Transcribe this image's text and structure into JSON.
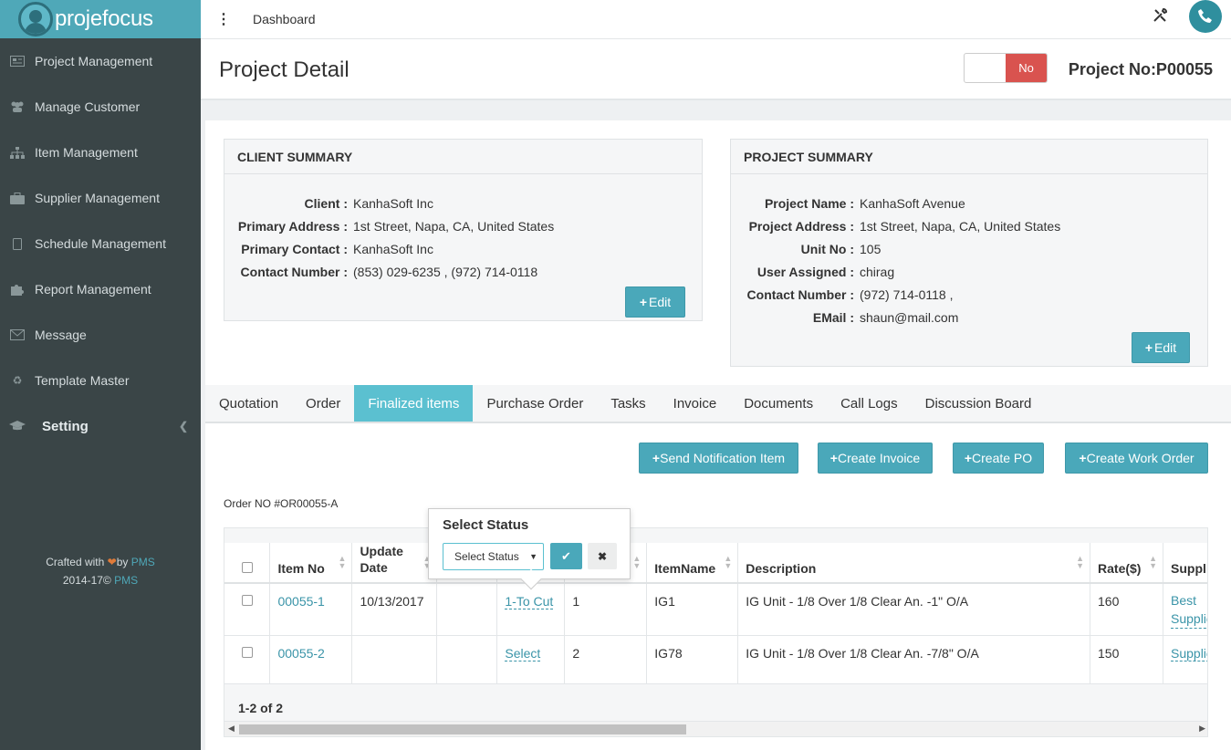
{
  "app": {
    "logo_text": "projefocus"
  },
  "sidebar": {
    "items": [
      {
        "label": "Project Management",
        "icon": "newspaper-icon"
      },
      {
        "label": "Manage Customer",
        "icon": "users-icon"
      },
      {
        "label": "Item Management",
        "icon": "sitemap-icon"
      },
      {
        "label": "Supplier Management",
        "icon": "briefcase-icon"
      },
      {
        "label": "Schedule Management",
        "icon": "tablet-icon"
      },
      {
        "label": "Report Management",
        "icon": "puzzle-icon"
      },
      {
        "label": "Message",
        "icon": "envelope-icon"
      },
      {
        "label": "Template Master",
        "icon": "recycle-icon"
      },
      {
        "label": "Setting",
        "icon": "graduation-cap-icon"
      }
    ],
    "credits_line1_prefix": "Crafted with ",
    "credits_line1_by": "by ",
    "credits_line1_link": "PMS",
    "credits_line2_prefix": "2014-17© ",
    "credits_line2_link": "PMS"
  },
  "topbar": {
    "breadcrumb": "Dashboard"
  },
  "header": {
    "title": "Project Detail",
    "toggle_label": "No",
    "project_no": "Project No:P00055"
  },
  "client_summary": {
    "title": "CLIENT SUMMARY",
    "rows": [
      {
        "key": "Client :",
        "value": "KanhaSoft Inc"
      },
      {
        "key": "Primary Address :",
        "value": "1st Street, Napa, CA, United States"
      },
      {
        "key": "Primary Contact :",
        "value": "KanhaSoft Inc"
      },
      {
        "key": "Contact Number :",
        "value": "(853) 029-6235 , (972) 714-0118"
      }
    ],
    "edit_label": "Edit"
  },
  "project_summary": {
    "title": "PROJECT SUMMARY",
    "rows": [
      {
        "key": "Project Name :",
        "value": "KanhaSoft Avenue"
      },
      {
        "key": "Project Address :",
        "value": "1st Street, Napa, CA, United States"
      },
      {
        "key": "Unit No :",
        "value": "105"
      },
      {
        "key": "User Assigned :",
        "value": "chirag"
      },
      {
        "key": "Contact Number :",
        "value": "(972) 714-0118 ,"
      },
      {
        "key": "EMail :",
        "value": "shaun@mail.com"
      }
    ],
    "edit_label": "Edit"
  },
  "tabs": [
    "Quotation",
    "Order",
    "Finalized items",
    "Purchase Order",
    "Tasks",
    "Invoice",
    "Documents",
    "Call Logs",
    "Discussion Board"
  ],
  "actions": {
    "send_notification": "Send Notification Item",
    "create_invoice": "Create Invoice",
    "create_po": "Create PO",
    "create_work_order": "Create Work Order"
  },
  "order_no": "Order NO #OR00055-A",
  "table": {
    "headers": [
      "Item No",
      "Update Date",
      "",
      "",
      "",
      "ItemName",
      "Description",
      "Rate($)",
      "Suppl"
    ],
    "rows": [
      {
        "item_no": "00055-1",
        "update_date": "10/13/2017",
        "status": "1-To Cut",
        "qty": "1",
        "item_name": "IG1",
        "description": "IG Unit - 1/8 Over 1/8 Clear An. -1\" O/A",
        "rate": "160",
        "supplier": "Best Supplie"
      },
      {
        "item_no": "00055-2",
        "update_date": "",
        "status": "Select",
        "qty": "2",
        "item_name": "IG78",
        "description": "IG Unit - 1/8 Over 1/8 Clear An. -7/8\" O/A",
        "rate": "150",
        "supplier": "Supplie"
      }
    ],
    "pagination": "1-2 of 2"
  },
  "popover": {
    "title": "Select Status",
    "select_value": "Select Status"
  },
  "colors": {
    "accent": "#4aa8ba",
    "sidebar": "#3a4547",
    "danger": "#d9534f",
    "active_tab": "#5bc0d0"
  }
}
